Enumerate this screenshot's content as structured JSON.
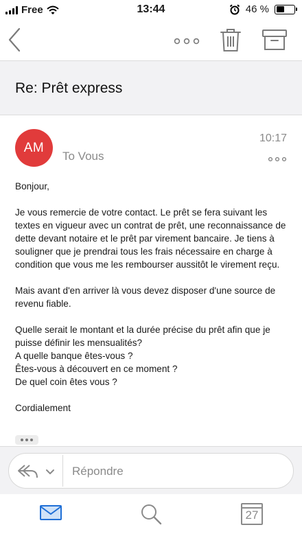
{
  "status_bar": {
    "carrier": "Free",
    "time": "13:44",
    "battery_text": "46 %",
    "battery_level": 0.46,
    "icons": [
      "signal-icon",
      "wifi-icon",
      "alarm-icon",
      "battery-icon"
    ]
  },
  "nav": {
    "icons": [
      "back-icon",
      "more-icon",
      "trash-icon",
      "archive-icon"
    ]
  },
  "subject": "Re: Prêt express",
  "message": {
    "avatar_initials": "AM",
    "avatar_color": "#e13b3b",
    "recipient": "To Vous",
    "time": "10:17",
    "body": {
      "p1": "Bonjour,",
      "p2": "Je vous remercie de votre contact. Le prêt se fera suivant les textes en vigueur avec un contrat de prêt, une reconnaissance de dette devant notaire et le prêt par virement bancaire. Je tiens à souligner que je prendrai tous les frais nécessaire en charge à condition que vous me les rembourser aussitôt le virement reçu.",
      "p3": "Mais avant d'en arriver là vous devez disposer d'une source de revenu fiable.",
      "p4_l1": "Quelle serait le montant et la durée précise du prêt afin que je puisse définir les mensualités?",
      "p4_l2": "A quelle banque êtes-vous ?",
      "p4_l3": "Êtes-vous à découvert en ce moment ?",
      "p4_l4": "De quel coin êtes vous ?",
      "p5": "Cordialement"
    }
  },
  "reply": {
    "placeholder": "Répondre"
  },
  "tabbar": {
    "calendar_day": "27",
    "active_tab": "mail",
    "active_color": "#1f6fd6"
  }
}
